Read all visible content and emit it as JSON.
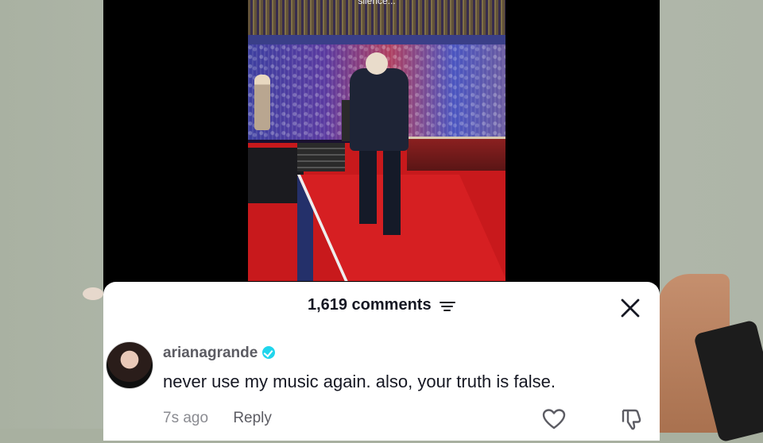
{
  "video": {
    "caption": "silence..."
  },
  "comments_panel": {
    "count_label": "1,619 comments",
    "filter_icon": "filter-lines-icon",
    "close_icon": "close-x-icon"
  },
  "comment": {
    "username": "arianagrande",
    "verified": true,
    "text": "never use my music again. also, your truth is false.",
    "timestamp": "7s ago",
    "reply_label": "Reply",
    "like_icon": "heart-outline-icon",
    "dislike_icon": "thumbs-down-outline-icon"
  },
  "colors": {
    "verified_badge": "#20d5ec",
    "text_primary": "#161823",
    "text_secondary": "#8a8b91"
  }
}
